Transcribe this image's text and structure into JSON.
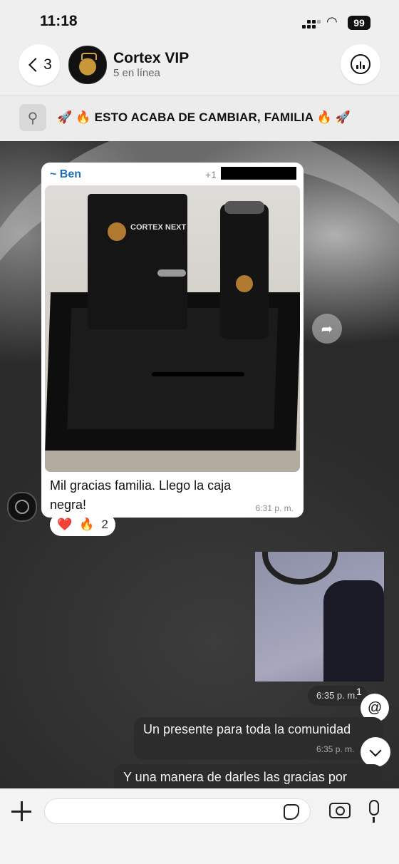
{
  "status_bar": {
    "time": "11:18",
    "battery": "99"
  },
  "header": {
    "back_count": "3",
    "title": "Cortex VIP",
    "subtitle": "5 en línea"
  },
  "pinned": {
    "text": "🚀 🔥 ESTO ACABA DE CAMBIAR, FAMILIA 🔥 🚀"
  },
  "messages": [
    {
      "sender": "~ Ben",
      "phone_prefix": "+1",
      "image_text": "CORTEX NEXT",
      "text": "Mil gracias familia. Llego la caja negra!",
      "time": "6:31 p. m.",
      "reactions": {
        "hearts": "❤️",
        "fire": "🔥",
        "count": "2"
      }
    },
    {
      "time": "6:35 p. m."
    },
    {
      "text": "Un presente para toda la comunidad",
      "time": "6:35 p. m."
    },
    {
      "text": "Y una manera de darles las gracias por"
    }
  ],
  "badges": {
    "mention_count": "1",
    "mention_symbol": "@"
  },
  "icons": {
    "forward": "➦",
    "pin": "📌"
  }
}
